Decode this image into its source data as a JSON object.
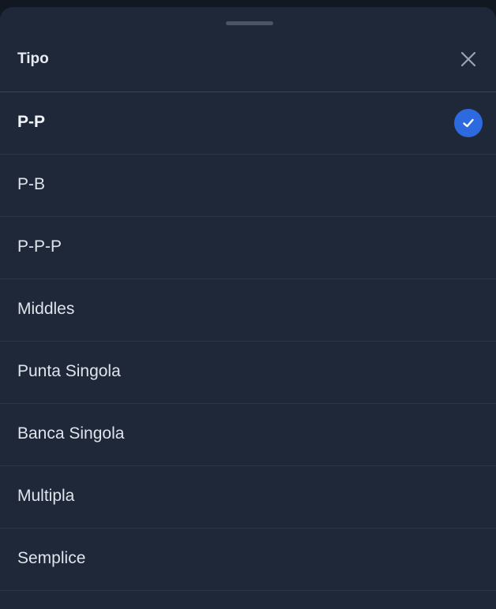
{
  "sheet": {
    "title": "Tipo",
    "selected_index": 0,
    "options": [
      {
        "label": "P-P"
      },
      {
        "label": "P-B"
      },
      {
        "label": "P-P-P"
      },
      {
        "label": "Middles"
      },
      {
        "label": "Punta Singola"
      },
      {
        "label": "Banca Singola"
      },
      {
        "label": "Multipla"
      },
      {
        "label": "Semplice"
      }
    ]
  },
  "icons": {
    "close": "close-icon",
    "check": "check-icon"
  },
  "colors": {
    "sheet_bg": "#1f2838",
    "accent": "#2d6ae0",
    "text": "#dfe4ec"
  }
}
